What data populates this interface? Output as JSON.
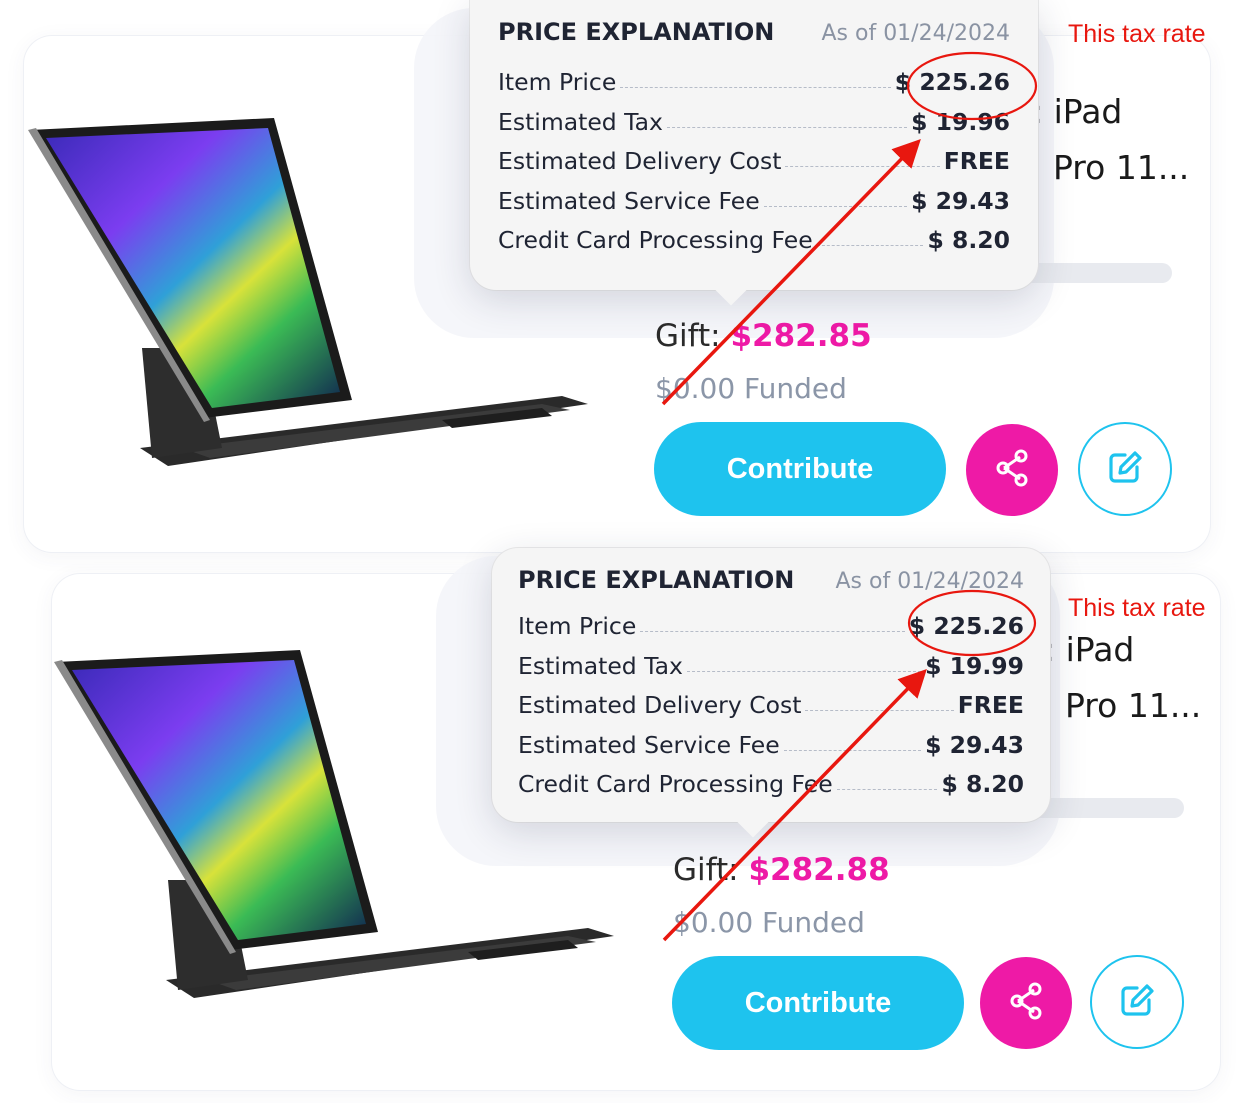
{
  "annotation": {
    "note": "This tax rate",
    "color": "#e8170f"
  },
  "cards": [
    {
      "image_icon": "ipad-with-keyboard-image",
      "title": ": iPad\n  Pro 11...",
      "progress": 0,
      "gift_label": "Gift: ",
      "gift_amount": "$282.85",
      "funded": "$0.00 Funded",
      "contribute_label": "Contribute",
      "share_icon": "share-icon",
      "edit_icon": "edit-icon",
      "popover": {
        "title": "PRICE EXPLANATION",
        "date": "As of 01/24/2024",
        "rows": [
          {
            "label": "Item Price",
            "value": "$ 225.26"
          },
          {
            "label": "Estimated Tax",
            "value": "$ 19.96"
          },
          {
            "label": "Estimated Delivery Cost",
            "value": "FREE"
          },
          {
            "label": "Estimated Service Fee",
            "value": "$ 29.43"
          },
          {
            "label": "Credit Card Processing Fee",
            "value": "$ 8.20"
          }
        ]
      }
    },
    {
      "image_icon": "ipad-with-keyboard-image",
      "title": ": iPad\n  Pro 11...",
      "progress": 0,
      "gift_label": "Gift: ",
      "gift_amount": "$282.88",
      "funded": "$0.00 Funded",
      "contribute_label": "Contribute",
      "share_icon": "share-icon",
      "edit_icon": "edit-icon",
      "popover": {
        "title": "PRICE EXPLANATION",
        "date": "As of 01/24/2024",
        "rows": [
          {
            "label": "Item Price",
            "value": "$ 225.26"
          },
          {
            "label": "Estimated Tax",
            "value": "$ 19.99"
          },
          {
            "label": "Estimated Delivery Cost",
            "value": "FREE"
          },
          {
            "label": "Estimated Service Fee",
            "value": "$ 29.43"
          },
          {
            "label": "Credit Card Processing Fee",
            "value": "$ 8.20"
          }
        ]
      }
    }
  ],
  "colors": {
    "accent_blue": "#1ec3ee",
    "accent_pink": "#ee1aa6",
    "text_dark": "#1f2433",
    "text_muted": "#8b96a8"
  }
}
